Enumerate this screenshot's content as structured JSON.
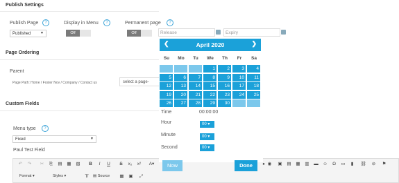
{
  "publish": {
    "title": "Publish Settings",
    "publish_page_label": "Publish Page",
    "publish_page_value": "Published",
    "display_menu_label": "Display in Menu",
    "display_menu_toggle": "Off",
    "permanent_label": "Permanent page",
    "permanent_toggle": "Off",
    "release_placeholder": "Release",
    "expiry_placeholder": "Expiry"
  },
  "ordering": {
    "title": "Page Ordering",
    "parent_label": "Parent",
    "path_prefix": "Page Path:",
    "path": [
      "Home",
      "Foster Nov",
      "Company",
      "Contact us"
    ],
    "parent_placeholder": "select a page-"
  },
  "custom": {
    "title": "Custom Fields",
    "menu_type_label": "Menu type",
    "menu_type_value": "Fixed",
    "test_field_label": "Paul Test Field"
  },
  "calendar": {
    "month_title": "April 2020",
    "days_of_week": [
      "Su",
      "Mo",
      "Tu",
      "We",
      "Th",
      "Fr",
      "Sa"
    ],
    "weeks": [
      [
        "",
        "",
        "",
        "1",
        "2",
        "3",
        "4"
      ],
      [
        "5",
        "6",
        "7",
        "8",
        "9",
        "10",
        "11"
      ],
      [
        "12",
        "13",
        "14",
        "15",
        "16",
        "17",
        "18"
      ],
      [
        "19",
        "20",
        "21",
        "22",
        "23",
        "24",
        "25"
      ],
      [
        "26",
        "27",
        "28",
        "29",
        "30",
        "",
        ""
      ]
    ],
    "time_label": "Time",
    "time_value": "00:00:00",
    "hour_label": "Hour",
    "hour_value": "00",
    "minute_label": "Minute",
    "minute_value": "00",
    "second_label": "Second",
    "second_value": "00",
    "now_label": "Now",
    "done_label": "Done",
    "accent": "#1ba1d9"
  },
  "editor": {
    "format_label": "Format",
    "styles_label": "Styles",
    "source_label": "Source"
  }
}
